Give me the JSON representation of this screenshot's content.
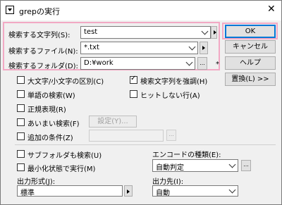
{
  "window": {
    "title": "grepの実行",
    "close_glyph": "✕"
  },
  "search": {
    "text_label": "検索する文字列(S):",
    "text_value": "test",
    "file_label": "検索するファイル(N):",
    "file_value": "*.txt",
    "folder_label": "検索するフォルダ(D):",
    "folder_value": "D:¥work",
    "browse_label": "...",
    "star_mark": "*"
  },
  "buttons": {
    "ok": "OK",
    "cancel": "キャンセル",
    "help": "ヘルプ",
    "replace": "置換(L) >>",
    "settings": "設定(Y)...",
    "cond_browse": "..."
  },
  "options": {
    "case": "大文字/小文字の区別(C)",
    "highlight": "検索文字列を強調(H)",
    "word": "単語の検索(W)",
    "invert": "ヒットしない行(A)",
    "regex": "正規表現(R)",
    "fuzzy": "あいまい検索(F)",
    "extra": "追加の条件(Z)",
    "subfolder": "サブフォルダも検索(U)",
    "minimize": "最小化状態で実行(M)"
  },
  "encoding": {
    "label": "エンコードの種類(E):",
    "value": "自動判定"
  },
  "output_format": {
    "label": "出力形式(J):",
    "value": "標準"
  },
  "output_target": {
    "label": "出力先(I):",
    "value": "自動"
  }
}
